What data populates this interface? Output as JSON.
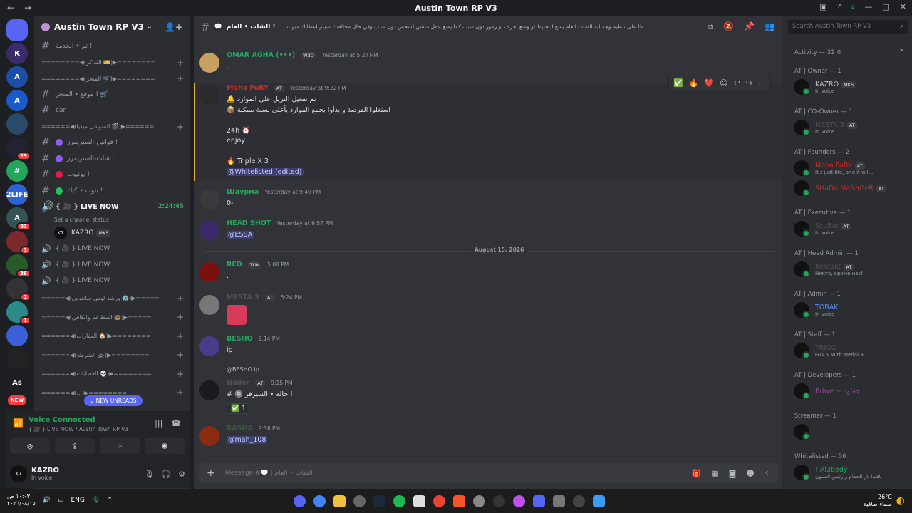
{
  "window": {
    "title": "Austin Town RP V3"
  },
  "guilds": [
    {
      "label": "",
      "badge": ""
    },
    {
      "label": "K",
      "badge": ""
    },
    {
      "label": "A",
      "badge": ""
    },
    {
      "label": "A",
      "badge": ""
    },
    {
      "label": "",
      "badge": ""
    },
    {
      "label": "",
      "badge": "29"
    },
    {
      "label": "#",
      "badge": ""
    },
    {
      "label": "2LIFE",
      "badge": ""
    },
    {
      "label": "A",
      "badge": "83"
    },
    {
      "label": "",
      "badge": "3"
    },
    {
      "label": "",
      "badge": "36"
    },
    {
      "label": "",
      "badge": "1"
    },
    {
      "label": "",
      "badge": "1"
    },
    {
      "label": "",
      "badge": ""
    },
    {
      "label": "",
      "badge": ""
    },
    {
      "label": "As",
      "badge": ""
    },
    {
      "label": "NEW",
      "badge": ""
    }
  ],
  "server": {
    "name": "Austin Town RP V3"
  },
  "channels": [
    {
      "kind": "text",
      "name": "تم • الخدمة !",
      "color": ""
    },
    {
      "kind": "cat",
      "name": "========◀(التذاكر 🎫)▶========",
      "color": ""
    },
    {
      "kind": "cat",
      "name": "========◀(المتجر 🛒)▶========",
      "color": ""
    },
    {
      "kind": "text",
      "name": "موقع • المتجر ! 🛒",
      "color": ""
    },
    {
      "kind": "text",
      "name": "car",
      "color": ""
    },
    {
      "kind": "cat",
      "name": "======◀(السوشل ميديا 🎬)▶======",
      "color": ""
    },
    {
      "kind": "text",
      "name": "قوانين-الستريمرز !",
      "color": "#8b5cf6"
    },
    {
      "kind": "text",
      "name": "شات-الستريمرز !",
      "color": "#8b5cf6"
    },
    {
      "kind": "text",
      "name": "يوتيوب !",
      "color": "#e11d48"
    },
    {
      "kind": "text",
      "name": "بثوث • كيك !",
      "color": "#22c55e"
    }
  ],
  "voice": {
    "live_label": "{ 🎥 } LIVE NOW",
    "timer": "2:24:45",
    "status_hint": "Set a channel status",
    "user": "KAZRO",
    "user_tag": "MKS",
    "extra_lives": [
      "{ 🎥 } LIVE NOW",
      "{ 🎥 } LIVE NOW",
      "{ 🎥 } LIVE NOW"
    ]
  },
  "lower_cats": [
    "=====◀(ورشة لوس سانتوس ⚙️)▶=====",
    "=====◀(المطاعم والكافي 🍩)▶=====",
    "======◀(العقارات 🏠)▶========",
    "======◀(الشرطة 🚓)▶========",
    "======◀(العصابات 💀)▶========",
    "======◀(...)▶========"
  ],
  "new_unreads": "NEW UNREADS",
  "voice_panel": {
    "status": "Voice Connected",
    "sub": "{ 🎥 } LIVE NOW / Austin Town RP V3"
  },
  "user_panel": {
    "name": "KAZRO",
    "status": "In voice"
  },
  "topbar": {
    "channel": "الشات • العام !",
    "topic": "حفاظاً على تنظيم وجمالية الشات العام يمنع التخبيط او وضع احرف او رموز دون سبب كما يمنع عمل منشن لشخص دون سبب وفي حال مخالفتك سيتم اعطائك ميوت"
  },
  "messages": [
    {
      "author": "OMAR AGHA (•••)",
      "color": "#23a55a",
      "tag": "W3D",
      "time": "Yesterday at 5:27 PM",
      "lines": [
        "."
      ]
    },
    {
      "author": "Moha FuRY",
      "color": "#c92a2a",
      "tag": "AT",
      "time": "Yesterday at 9:22 PM",
      "lines": [
        "🔔 تم تفعيل النزيل على الموارد",
        "📦 استغلوا الفرصة وابدأوا بجمع الموارد بأعلى نسبة ممكنة",
        "",
        "24h ⏰",
        "enjoy",
        "",
        "🔥 Triple X 3",
        "@Whitelisted (edited)"
      ]
    },
    {
      "author": "Шаурма",
      "color": "#23a55a",
      "tag": "",
      "time": "Yesterday at 9:49 PM",
      "lines": [
        "0-"
      ]
    },
    {
      "author": "HEAD SHOT",
      "color": "#23a55a",
      "tag": "",
      "time": "Yesterday at 9:57 PM",
      "lines": [
        "@ESSA"
      ]
    },
    {
      "author": "RED",
      "color": "#23a55a",
      "tag": "TOK",
      "time": "5:08 PM",
      "lines": [
        "."
      ]
    },
    {
      "author": "MESTA 3",
      "color": "#4e5058",
      "tag": "AT",
      "time": "5:24 PM",
      "lines": [
        ""
      ]
    },
    {
      "author": "BESHO",
      "color": "#23a55a",
      "tag": "",
      "time": "9:14 PM",
      "lines": [
        "ip"
      ]
    },
    {
      "author": "Nader",
      "color": "#4e5058",
      "tag": "AT",
      "time": "9:15 PM",
      "lines": [
        "# 🔘 حالة • السيرفر !"
      ],
      "reply": "@BESHO ip",
      "reaction": "✅ 1"
    },
    {
      "author": "BASHA",
      "color": "#3a5a3a",
      "tag": "",
      "time": "9:38 PM",
      "lines": [
        "@mah_108"
      ]
    }
  ],
  "date_divider": "August 15, 2026",
  "composer": {
    "placeholder": "Message #💬 | الشات • العام !"
  },
  "members": {
    "search_placeholder": "Search Austin Town RP V3",
    "activity": "Activity — 31 ⚙",
    "groups": [
      {
        "header": "AT | Owner — 1",
        "members": [
          {
            "name": "KAZRO",
            "color": "#b5bac1",
            "sub": "In voice",
            "tag": "MKS"
          }
        ]
      },
      {
        "header": "AT | CO-Owner — 1",
        "members": [
          {
            "name": "MESTA 3",
            "color": "#4e5058",
            "sub": "In voice",
            "tag": "AT"
          }
        ]
      },
      {
        "header": "AT | Founders — 2",
        "members": [
          {
            "name": "Moha FuRY",
            "color": "#c92a2a",
            "sub": "It's just life, and it wil...",
            "tag": "AT"
          },
          {
            "name": "SHaDo MaNaGeR",
            "color": "#c92a2a",
            "sub": "",
            "tag": "AT"
          }
        ]
      },
      {
        "header": "AT | Executive — 1",
        "members": [
          {
            "name": "ScuBaI",
            "color": "#4e5058",
            "sub": "In voice",
            "tag": "AT"
          }
        ]
      },
      {
        "header": "AT | Head Admin — 1",
        "members": [
          {
            "name": "Kontakt",
            "color": "#4e5058",
            "sub": "Никто, кроме нас!",
            "tag": "AT"
          }
        ]
      },
      {
        "header": "AT | Admin — 1",
        "members": [
          {
            "name": "TOBAK",
            "color": "#5b8def",
            "sub": "In voice",
            "tag": ""
          }
        ]
      },
      {
        "header": "AT | Staff — 1",
        "members": [
          {
            "name": "TRIGO",
            "color": "#4e5058",
            "sub": "GTA V with Medal +1",
            "tag": ""
          }
        ]
      },
      {
        "header": "AT | Developers — 1",
        "members": [
          {
            "name": "Bdwe ✧ جعلود",
            "color": "#8b4d8b",
            "sub": "",
            "tag": ""
          }
        ]
      },
      {
        "header": "Streamer — 1",
        "members": [
          {
            "name": "",
            "color": "#5b3b9a",
            "sub": "",
            "tag": ""
          }
        ]
      },
      {
        "header": "Whitelisted — 56",
        "members": [
          {
            "name": "! Al3bedy",
            "color": "#23a55a",
            "sub": "يافندا نار الحمام و رئيس الصبون",
            "tag": ""
          }
        ]
      }
    ]
  },
  "taskbar": {
    "clock": "١٠:٠٣ ص",
    "date": "٢٠٢٦/٠٨/١٥",
    "lang": "ENG",
    "temp": "26°C",
    "weather": "سماء صافية"
  }
}
